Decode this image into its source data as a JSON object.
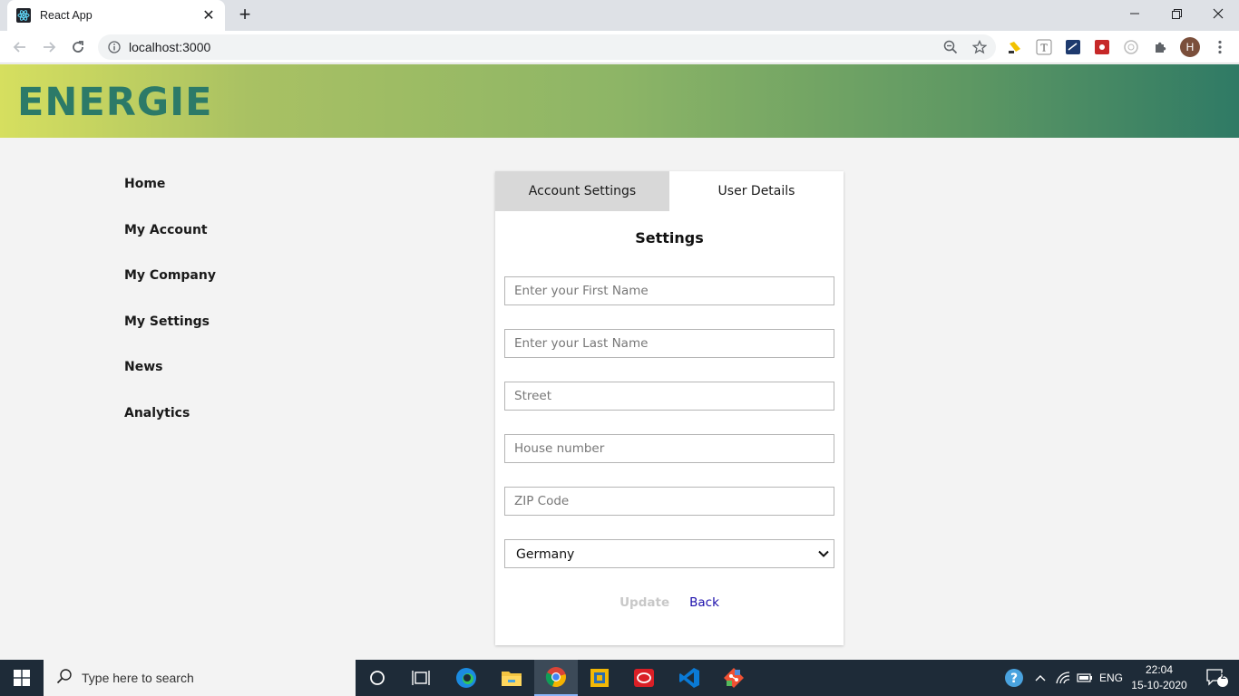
{
  "browser": {
    "tab_title": "React App",
    "url": "localhost:3000",
    "profile_initial": "H"
  },
  "app": {
    "brand": "ENERGIE"
  },
  "sidebar": {
    "items": [
      {
        "label": "Home"
      },
      {
        "label": "My Account"
      },
      {
        "label": "My Company"
      },
      {
        "label": "My Settings"
      },
      {
        "label": "News"
      },
      {
        "label": "Analytics"
      }
    ]
  },
  "card": {
    "tabs": [
      {
        "label": "Account Settings",
        "active": false
      },
      {
        "label": "User Details",
        "active": true
      }
    ],
    "title": "Settings",
    "fields": {
      "first_name_placeholder": "Enter your First Name",
      "last_name_placeholder": "Enter your Last Name",
      "street_placeholder": "Street",
      "house_number_placeholder": "House number",
      "zip_placeholder": "ZIP Code"
    },
    "country_selected": "Germany",
    "update_label": "Update",
    "back_label": "Back"
  },
  "taskbar": {
    "search_placeholder": "Type here to search",
    "language": "ENG",
    "time": "22:04",
    "date": "15-10-2020",
    "notification_count": "2"
  },
  "colors": {
    "brand_text": "#2c7a68",
    "header_gradient_start": "#d6df5f",
    "header_gradient_end": "#2f7a65",
    "link": "#1a0dab",
    "inactive_tab": "#d8d8d8"
  }
}
